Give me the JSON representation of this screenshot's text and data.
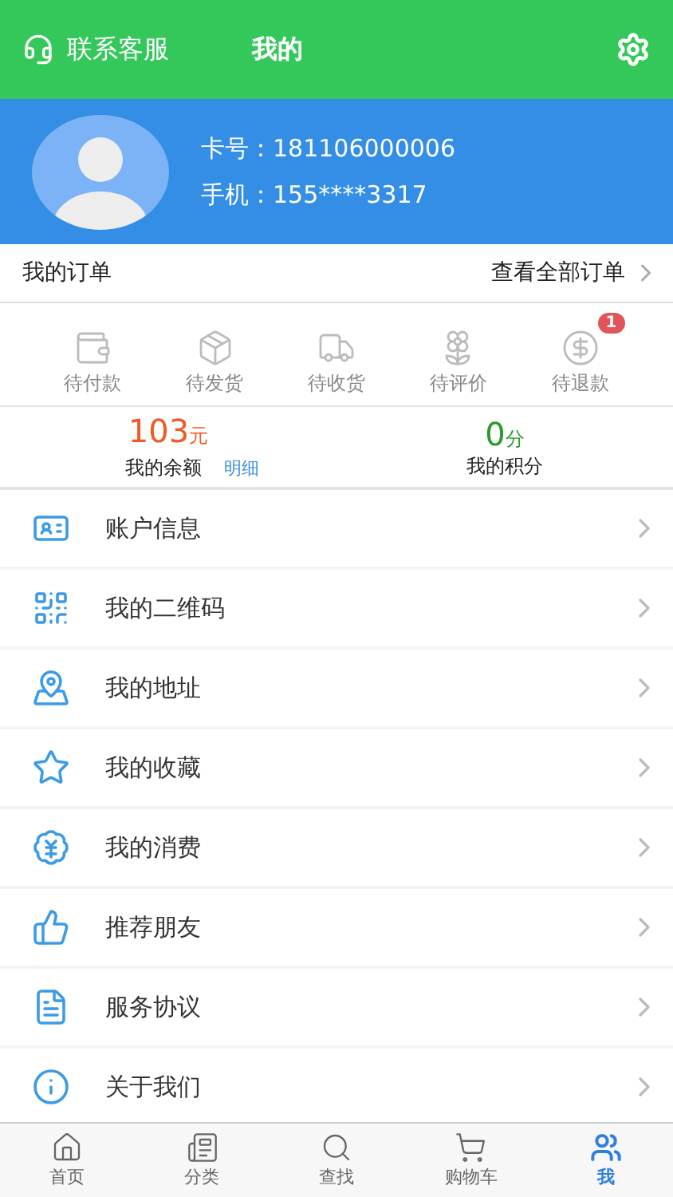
{
  "header": {
    "left_label": "联系客服",
    "title": "我的"
  },
  "profile": {
    "card": "卡号：181106000006",
    "phone": "手机：155****3317"
  },
  "orders": {
    "title": "我的订单",
    "link": "查看全部订单",
    "statuses": [
      {
        "label": "待付款"
      },
      {
        "label": "待发货"
      },
      {
        "label": "待收货"
      },
      {
        "label": "待评价"
      },
      {
        "label": "待退款",
        "badge": "1"
      }
    ]
  },
  "balance": {
    "amount": "103",
    "unit": "元",
    "label": "我的余额",
    "detail": "明细"
  },
  "points": {
    "amount": "0",
    "unit": "分",
    "label": "我的积分"
  },
  "menu": [
    {
      "label": "账户信息"
    },
    {
      "label": "我的二维码"
    },
    {
      "label": "我的地址"
    },
    {
      "label": "我的收藏"
    },
    {
      "label": "我的消费"
    },
    {
      "label": "推荐朋友"
    },
    {
      "label": "服务协议"
    },
    {
      "label": "关于我们"
    }
  ],
  "tabbar": [
    {
      "label": "首页",
      "selected": false
    },
    {
      "label": "分类",
      "selected": false
    },
    {
      "label": "查找",
      "selected": false
    },
    {
      "label": "购物车",
      "selected": false
    },
    {
      "label": "我",
      "selected": true
    }
  ]
}
